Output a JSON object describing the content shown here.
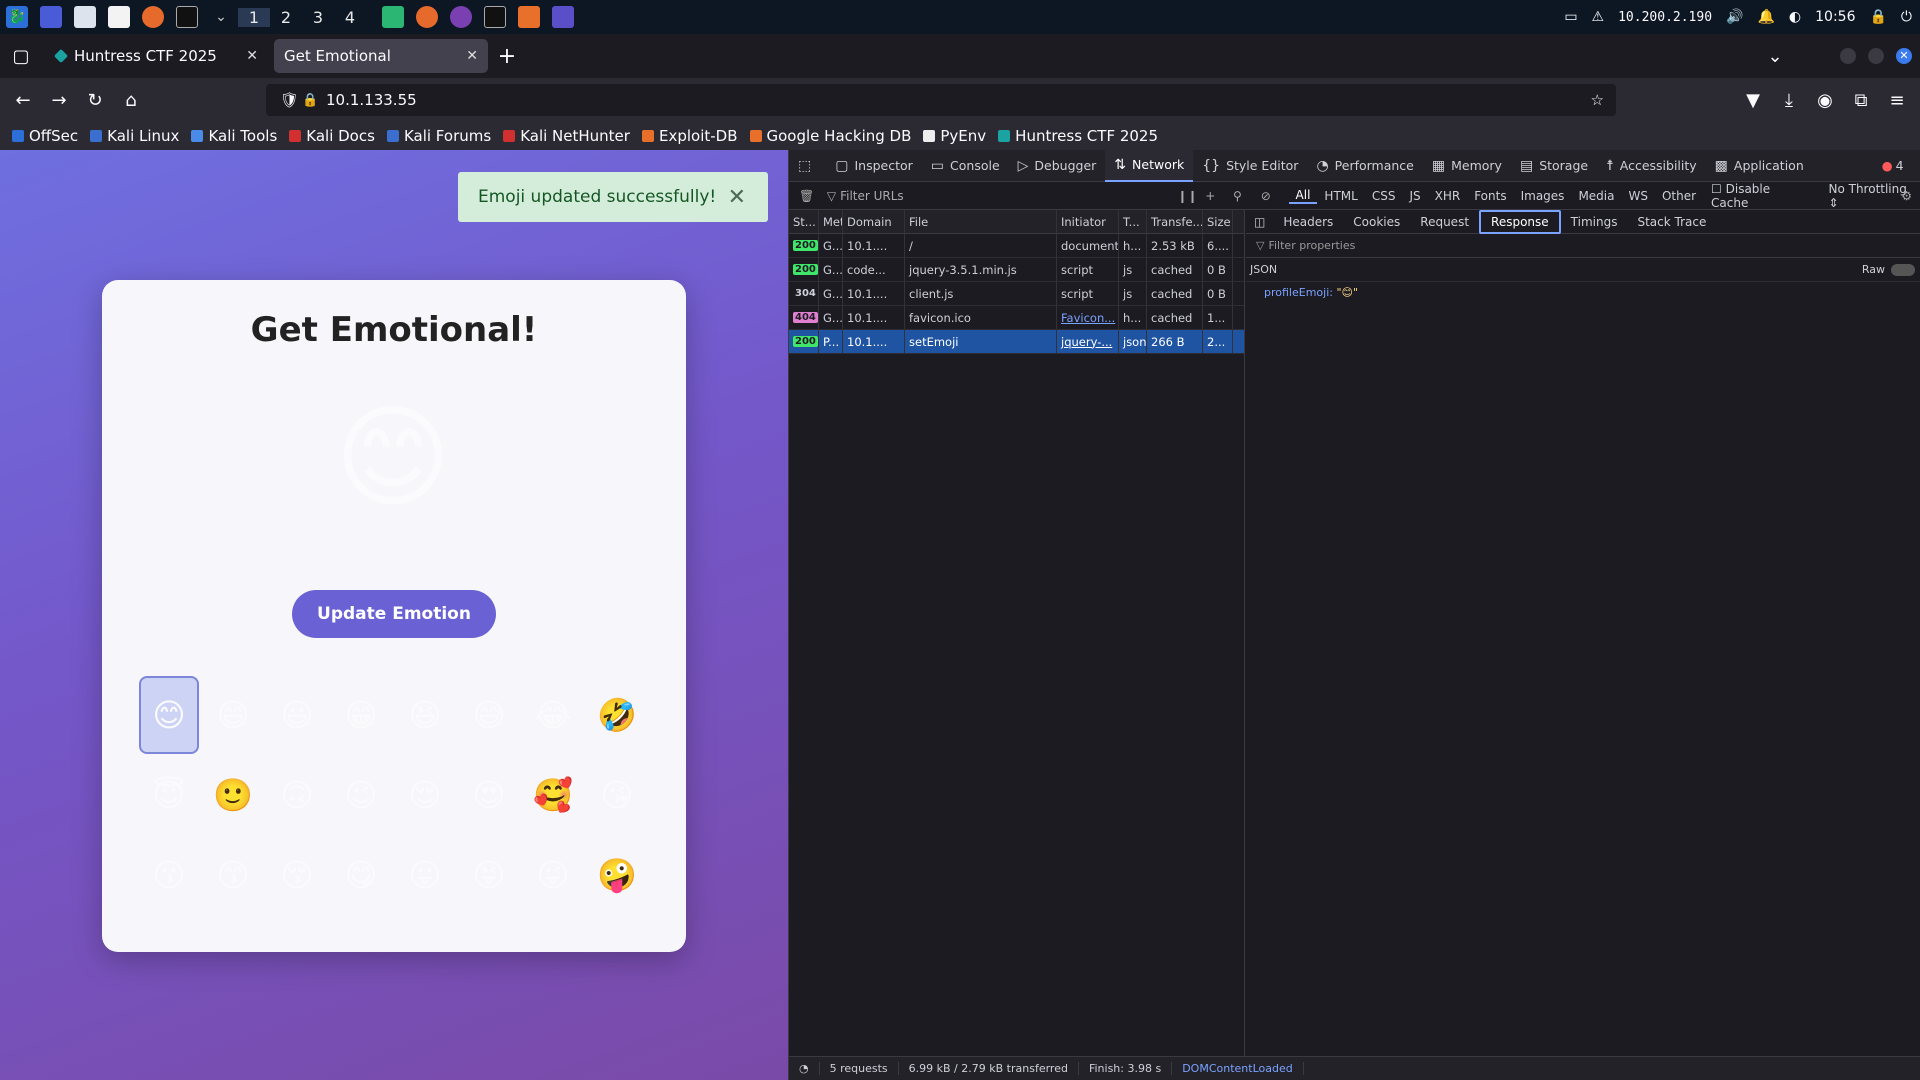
{
  "panel": {
    "workspaces": [
      "1",
      "2",
      "3",
      "4"
    ],
    "ip": "10.200.2.190",
    "time": "10:56"
  },
  "tabs": [
    {
      "title": "Huntress CTF 2025"
    },
    {
      "title": "Get Emotional"
    }
  ],
  "navbar": {
    "url": "10.1.133.55"
  },
  "bookmarks": [
    "OffSec",
    "Kali Linux",
    "Kali Tools",
    "Kali Docs",
    "Kali Forums",
    "Kali NetHunter",
    "Exploit-DB",
    "Google Hacking DB",
    "PyEnv",
    "Huntress CTF 2025"
  ],
  "page": {
    "toast": "Emoji updated successfully!",
    "title": "Get Emotional!",
    "selected_emoji": "😊",
    "button": "Update Emotion",
    "emojis": [
      "😊",
      "😄",
      "😃",
      "😁",
      "😆",
      "😅",
      "😂",
      "🤣",
      "😇",
      "🙂",
      "🙃",
      "😉",
      "😌",
      "😍",
      "🥰",
      "😘",
      "😗",
      "😙",
      "😚",
      "😋",
      "😛",
      "😝",
      "😜",
      "🤪"
    ]
  },
  "devtools": {
    "tabs": [
      "Inspector",
      "Console",
      "Debugger",
      "Network",
      "Style Editor",
      "Performance",
      "Memory",
      "Storage",
      "Accessibility",
      "Application"
    ],
    "error_count": "4",
    "filter_placeholder": "Filter URLs",
    "filter_types": [
      "All",
      "HTML",
      "CSS",
      "JS",
      "XHR",
      "Fonts",
      "Images",
      "Media",
      "WS",
      "Other"
    ],
    "disable_cache": "Disable Cache",
    "throttling": "No Throttling ⇕",
    "columns": [
      "St...",
      "Met",
      "Domain",
      "File",
      "Initiator",
      "T...",
      "Transfe...",
      "Size"
    ],
    "rows": [
      {
        "status": "200",
        "method": "G...",
        "domain": "10.1....",
        "file": "/",
        "initiator": "document",
        "type": "h...",
        "transferred": "2.53 kB",
        "size": "6...."
      },
      {
        "status": "200",
        "method": "G...",
        "domain": "code...",
        "file": "jquery-3.5.1.min.js",
        "initiator": "script",
        "type": "js",
        "transferred": "cached",
        "size": "0 B"
      },
      {
        "status": "304",
        "method": "G...",
        "domain": "10.1....",
        "file": "client.js",
        "initiator": "script",
        "type": "js",
        "transferred": "cached",
        "size": "0 B"
      },
      {
        "status": "404",
        "method": "G...",
        "domain": "10.1....",
        "file": "favicon.ico",
        "initiator": "Favicon...",
        "type": "h...",
        "transferred": "cached",
        "size": "1..."
      },
      {
        "status": "200",
        "method": "P...",
        "domain": "10.1....",
        "file": "setEmoji",
        "initiator": "jquery-...",
        "type": "json",
        "transferred": "266 B",
        "size": "2..."
      }
    ],
    "detail_tabs": [
      "Headers",
      "Cookies",
      "Request",
      "Response",
      "Timings",
      "Stack Trace"
    ],
    "filter_properties": "Filter properties",
    "json_label": "JSON",
    "raw_label": "Raw",
    "json_key": "profileEmoji:",
    "json_value": "\"😊\"",
    "status": {
      "requests": "5 requests",
      "transferred": "6.99 kB / 2.79 kB transferred",
      "finish": "Finish: 3.98 s",
      "dcl": "DOMContentLoaded"
    }
  }
}
